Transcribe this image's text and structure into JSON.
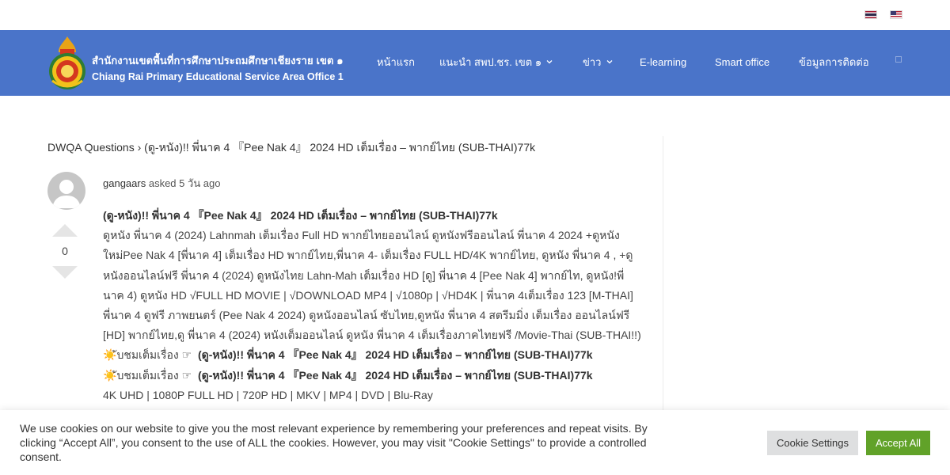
{
  "flags": {
    "thai": "thai-flag-icon",
    "english": "us-flag-icon"
  },
  "header": {
    "bg_color": "#4a74c9",
    "logo_title_th": "สำนักงานเขตพื้นที่การศึกษาประถมศึกษาเชียงราย เขต ๑",
    "logo_title_en": "Chiang Rai Primary Educational Service Area Office 1",
    "nav": [
      {
        "label": "หน้าแรก",
        "has_dropdown": false
      },
      {
        "label": "แนะนำ สพป.ชร. เขต ๑",
        "has_dropdown": true
      },
      {
        "label": "ข่าว",
        "has_dropdown": true
      },
      {
        "label": "E-learning",
        "has_dropdown": false
      },
      {
        "label": "Smart office",
        "has_dropdown": false
      },
      {
        "label": "ข้อมูลการติดต่อ",
        "has_dropdown": false
      }
    ]
  },
  "breadcrumb": {
    "root": "DWQA Questions",
    "separator": "›",
    "current": "(ดู-หนัง)!! พี่นาค 4 『Pee Nak 4』 2024 HD เต็มเรื่อง – พากย์ไทย (SUB-THAI)77k"
  },
  "question": {
    "author": "gangaars",
    "asked_label": "asked",
    "time": "5 วัน ago",
    "votes": "0",
    "title": "(ดู-หนัง)!! พี่นาค 4 『Pee Nak 4』 2024 HD เต็มเรื่อง – พากย์ไทย (SUB-THAI)77k",
    "body": "ดูหนัง พี่นาค 4 (2024) Lahnmah เต็มเรื่อง Full HD พากย์ไทยออนไลน์ ดูหนังฟรีออนไลน์ พี่นาค 4 2024 +ดูหนังใหม่Pee Nak 4 [พี่นาค 4] เต็มเรื่อง HD พากย์ไทย,พี่นาค 4- เต็มเรื่อง FULL HD/4K พากย์ไทย, ดูหนัง พี่นาค 4 , +ดูหนังออนไลน์ฟรี พี่นาค 4 (2024) ดูหนังไทย Lahn-Mah เต็มเรื่อง HD [ดู] พี่นาค 4 [Pee Nak 4] พากย์ไท, ดูหนัง!พี่นาค 4) ดูหนัง HD √FULL HD MOVIE | √DOWNLOAD MP4 | √1080p | √HD4K | พี่นาค 4เต็มเรื่อง 123 [M-THAI] พี่นาค 4 ดูฟรี ภาพยนตร์ (Pee Nak 4 2024) ดูหนังออนไลน์ ซับไทย,ดูหนัง พี่นาค 4 สตรีมมิ่ง เต็มเรื่อง ออนไลน์ฟรี [HD] พากย์ไทย,ดู พี่นาค 4 (2024) หนังเต็มออนไลน์ ดูหนัง พี่นาค 4 เต็มเรื่องภาคไทยฟรี /Movie-Thai (SUB-THAI!!)",
    "watch_prefix": "ับชมเต็มเรื่อง ☞",
    "watch_link": "(ดู-หนัง)!! พี่นาค 4 『Pee Nak 4』 2024 HD เต็มเรื่อง – พากย์ไทย (SUB-THAI)77k",
    "formats": "4K UHD | 1080P FULL HD | 720P HD | MKV | MP4 | DVD | Blu-Ray"
  },
  "cookie": {
    "text": "We use cookies on our website to give you the most relevant experience by remembering your preferences and repeat visits. By clicking “Accept All”, you consent to the use of ALL the cookies. However, you may visit \"Cookie Settings\" to provide a controlled consent.",
    "settings_label": "Cookie Settings",
    "accept_label": "Accept All",
    "accept_color": "#61a229"
  }
}
